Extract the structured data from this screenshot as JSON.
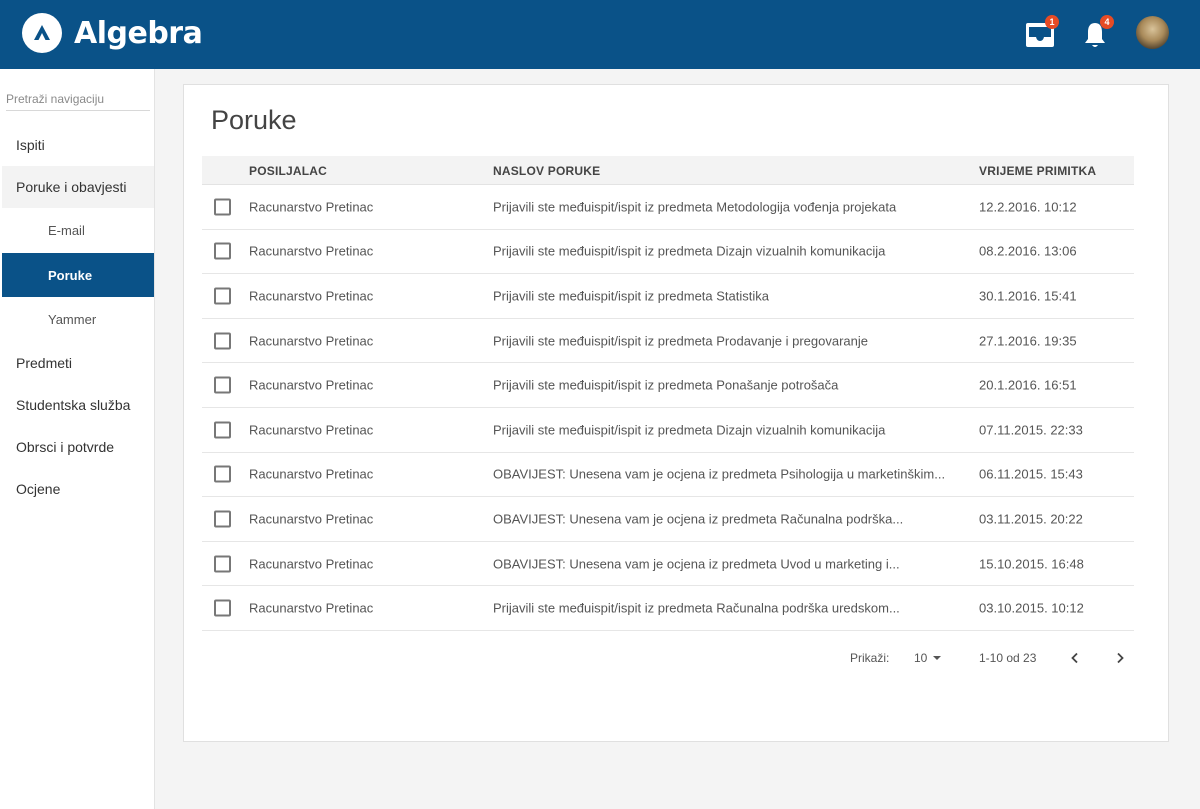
{
  "app": {
    "brand": "Algebra",
    "mail_badge": "1",
    "notif_badge": "4"
  },
  "sidebar": {
    "search_placeholder": "Pretraži navigaciju",
    "items": [
      {
        "label": "Ispiti"
      },
      {
        "label": "Poruke i obavjesti"
      },
      {
        "label": "E-mail"
      },
      {
        "label": "Poruke"
      },
      {
        "label": "Yammer"
      },
      {
        "label": "Predmeti"
      },
      {
        "label": "Studentska služba"
      },
      {
        "label": "Obrsci i potvrde"
      },
      {
        "label": "Ocjene"
      }
    ]
  },
  "main": {
    "title": "Poruke",
    "columns": {
      "sender": "POSILJALAC",
      "subject": "NASLOV PORUKE",
      "time": "VRIJEME PRIMITKA"
    },
    "rows": [
      {
        "sender": "Racunarstvo Pretinac",
        "subject": "Prijavili ste međuispit/ispit iz predmeta Metodologija vođenja projekata",
        "time": "12.2.2016. 10:12"
      },
      {
        "sender": "Racunarstvo Pretinac",
        "subject": "Prijavili ste međuispit/ispit iz predmeta Dizajn vizualnih komunikacija",
        "time": "08.2.2016. 13:06"
      },
      {
        "sender": "Racunarstvo Pretinac",
        "subject": "Prijavili ste međuispit/ispit iz predmeta Statistika",
        "time": "30.1.2016. 15:41"
      },
      {
        "sender": "Racunarstvo Pretinac",
        "subject": "Prijavili ste međuispit/ispit iz predmeta Prodavanje i pregovaranje",
        "time": "27.1.2016. 19:35"
      },
      {
        "sender": "Racunarstvo Pretinac",
        "subject": "Prijavili ste međuispit/ispit iz predmeta Ponašanje potrošača",
        "time": "20.1.2016. 16:51"
      },
      {
        "sender": "Racunarstvo Pretinac",
        "subject": "Prijavili ste međuispit/ispit iz predmeta Dizajn vizualnih komunikacija",
        "time": "07.11.2015. 22:33"
      },
      {
        "sender": "Racunarstvo Pretinac",
        "subject": "OBAVIJEST: Unesena vam je ocjena iz predmeta Psihologija u marketinškim...",
        "time": "06.11.2015. 15:43"
      },
      {
        "sender": "Racunarstvo Pretinac",
        "subject": "OBAVIJEST: Unesena vam je ocjena iz predmeta Računalna podrška...",
        "time": "03.11.2015. 20:22"
      },
      {
        "sender": "Racunarstvo Pretinac",
        "subject": "OBAVIJEST: Unesena vam je ocjena iz predmeta Uvod u marketing i...",
        "time": "15.10.2015. 16:48"
      },
      {
        "sender": "Racunarstvo Pretinac",
        "subject": "Prijavili ste međuispit/ispit iz predmeta Računalna podrška uredskom...",
        "time": "03.10.2015. 10:12"
      }
    ],
    "pager": {
      "label": "Prikaži:",
      "page_size": "10",
      "range": "1-10 od 23"
    }
  }
}
